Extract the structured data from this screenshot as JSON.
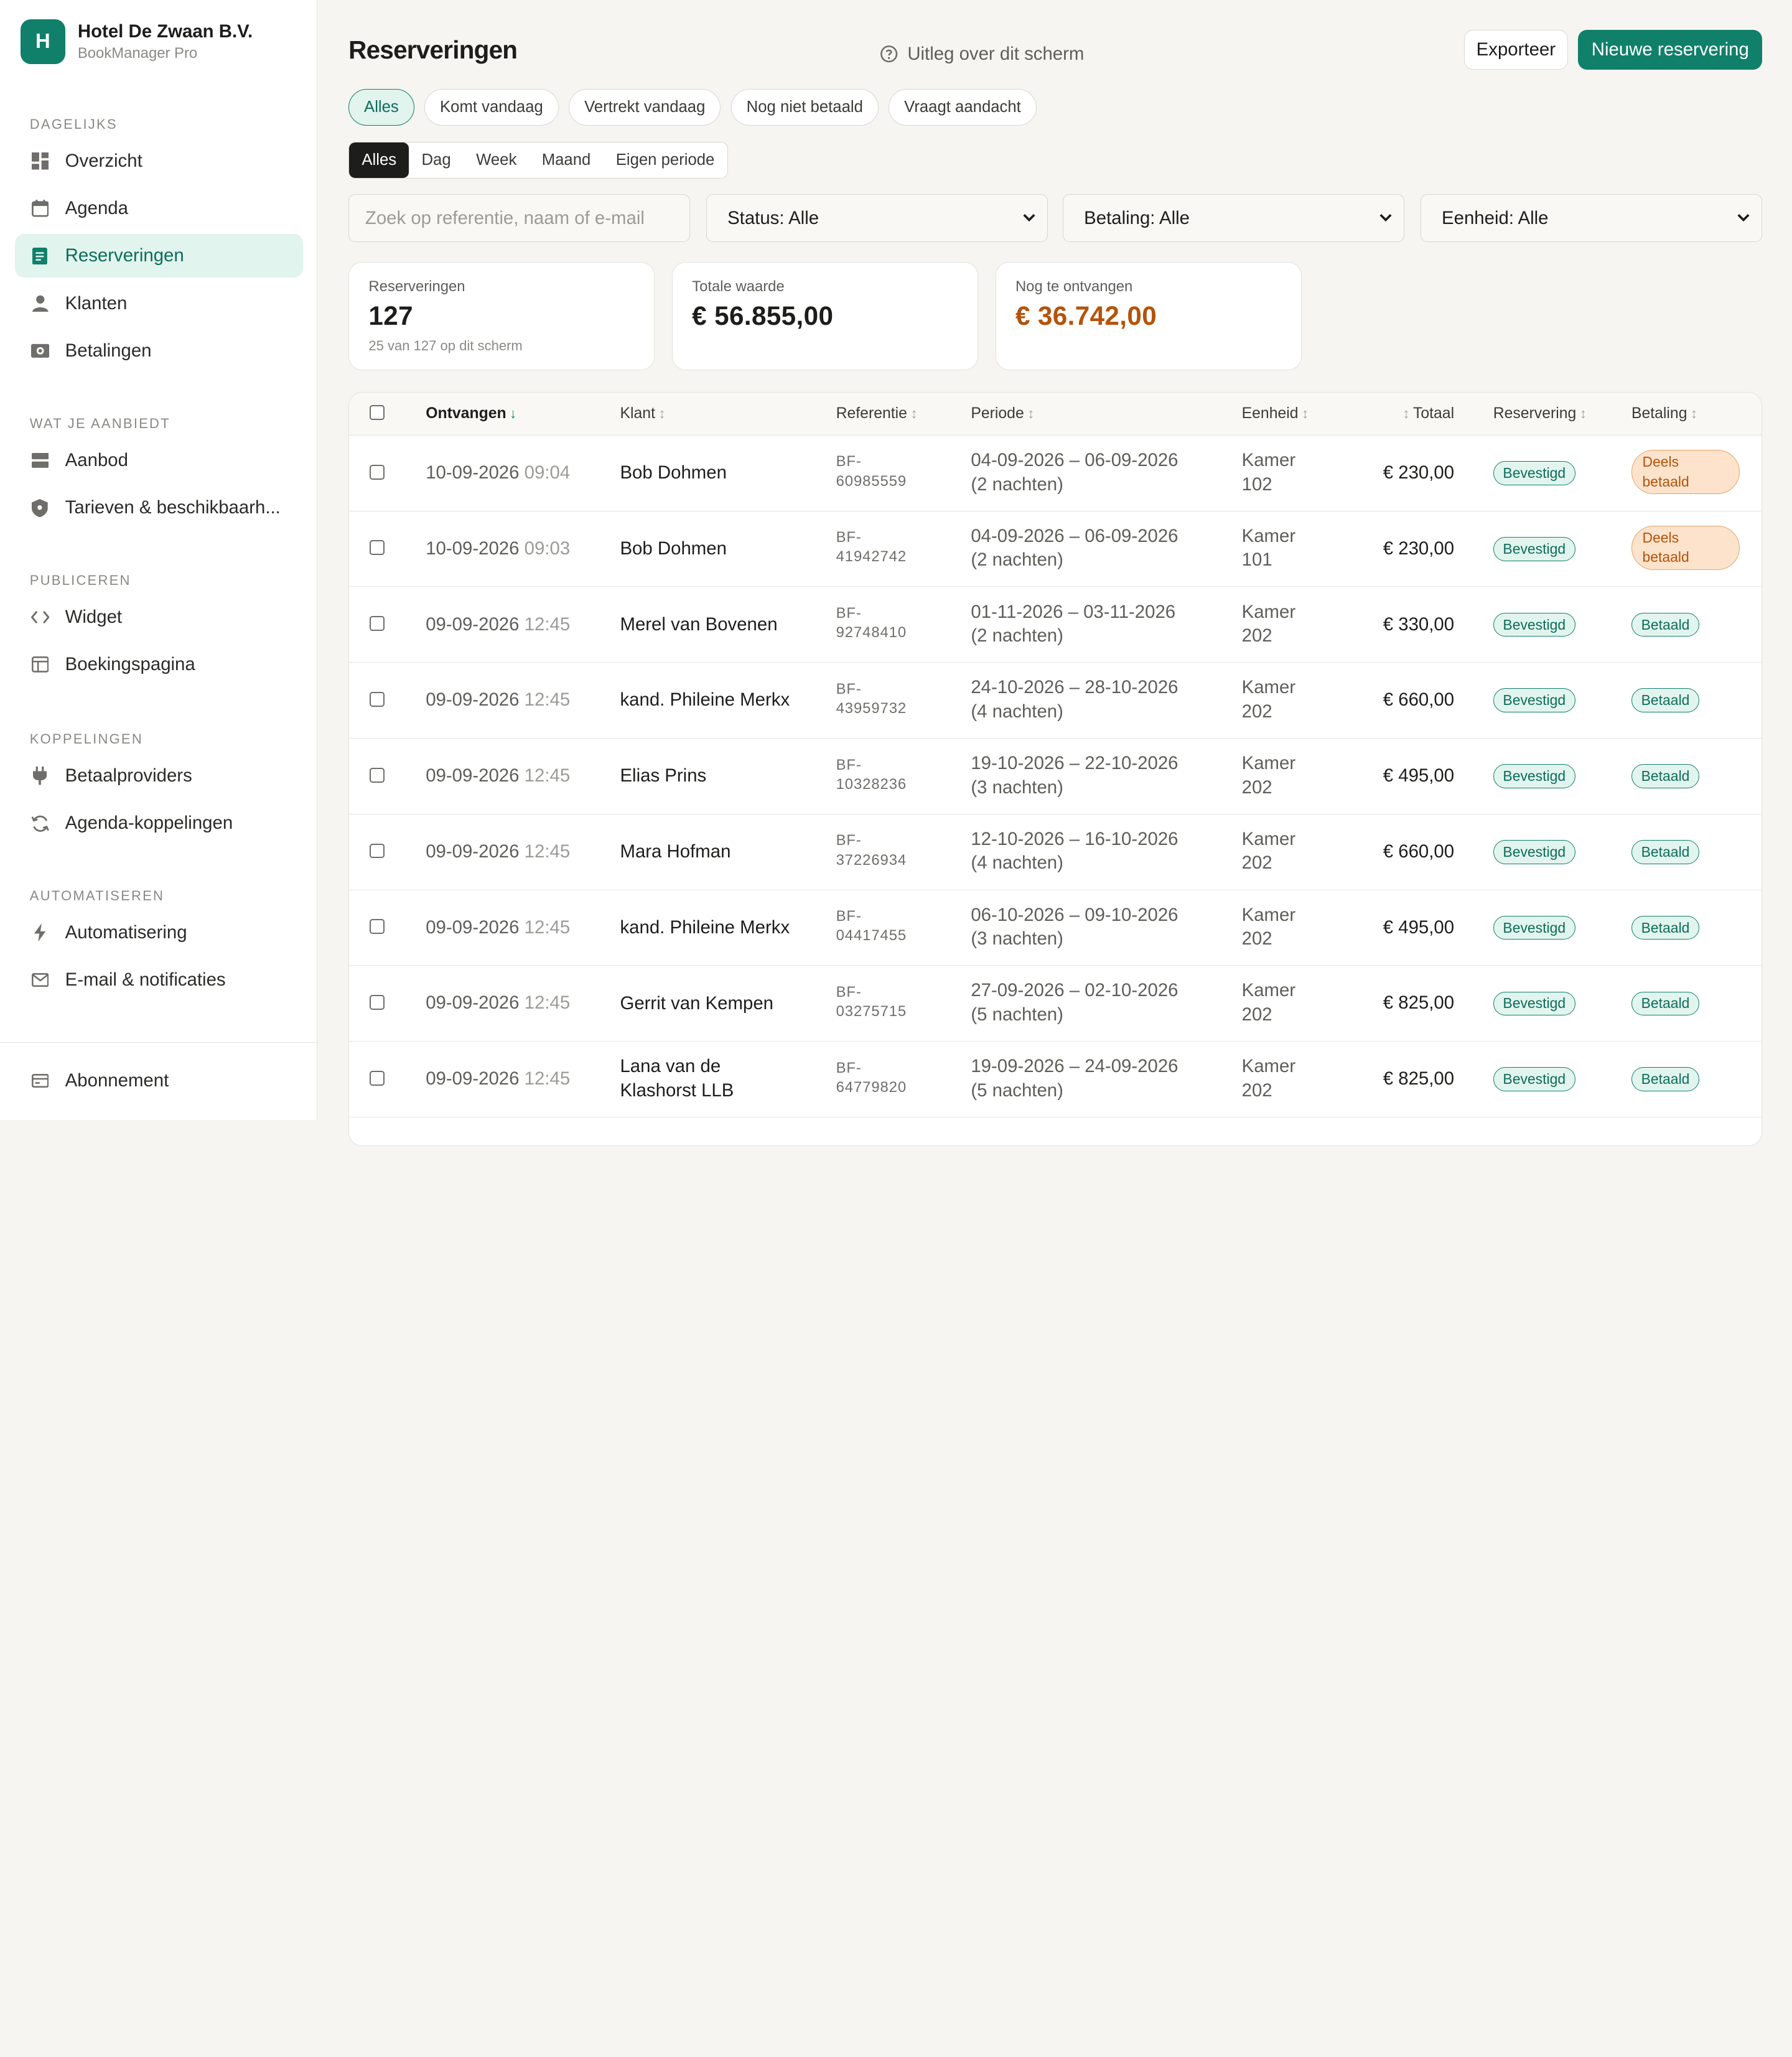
{
  "brand": {
    "initial": "H",
    "name": "Hotel De Zwaan B.V.",
    "product": "BookManager Pro"
  },
  "sidebar": {
    "sections": [
      {
        "title": "DAGELIJKS",
        "items": [
          {
            "label": "Overzicht",
            "icon": "dashboard-icon"
          },
          {
            "label": "Agenda",
            "icon": "calendar-icon"
          },
          {
            "label": "Reserveringen",
            "icon": "document-icon",
            "active": true
          },
          {
            "label": "Klanten",
            "icon": "user-icon"
          },
          {
            "label": "Betalingen",
            "icon": "payment-icon"
          }
        ]
      },
      {
        "title": "WAT JE AANBIEDT",
        "items": [
          {
            "label": "Aanbod",
            "icon": "offer-icon"
          },
          {
            "label": "Tarieven & beschikbaarh...",
            "icon": "tag-shield-icon"
          }
        ]
      },
      {
        "title": "PUBLICEREN",
        "items": [
          {
            "label": "Widget",
            "icon": "code-icon"
          },
          {
            "label": "Boekingspagina",
            "icon": "layout-icon"
          }
        ]
      },
      {
        "title": "KOPPELINGEN",
        "items": [
          {
            "label": "Betaalproviders",
            "icon": "plug-icon"
          },
          {
            "label": "Agenda-koppelingen",
            "icon": "sync-icon"
          }
        ]
      },
      {
        "title": "AUTOMATISEREN",
        "items": [
          {
            "label": "Automatisering",
            "icon": "bolt-icon"
          },
          {
            "label": "E-mail & notificaties",
            "icon": "mail-icon"
          }
        ]
      }
    ],
    "footer": {
      "label": "Abonnement",
      "icon": "card-icon"
    }
  },
  "header": {
    "title": "Reserveringen",
    "help": "Uitleg over dit scherm",
    "export": "Exporteer",
    "new": "Nieuwe reservering"
  },
  "quick_filters": [
    "Alles",
    "Komt vandaag",
    "Vertrekt vandaag",
    "Nog niet betaald",
    "Vraagt aandacht"
  ],
  "periods": [
    "Alles",
    "Dag",
    "Week",
    "Maand",
    "Eigen periode"
  ],
  "filters": {
    "search_placeholder": "Zoek op referentie, naam of e-mail",
    "status": "Status: Alle",
    "payment": "Betaling: Alle",
    "unit": "Eenheid: Alle"
  },
  "stats": [
    {
      "label": "Reserveringen",
      "value": "127",
      "sub": "25 van 127 op dit scherm"
    },
    {
      "label": "Totale waarde",
      "value": "€ 56.855,00"
    },
    {
      "label": "Nog te ontvangen",
      "value": "€ 36.742,00",
      "color": "#b45309"
    }
  ],
  "table": {
    "columns": {
      "received": "Ontvangen",
      "customer": "Klant",
      "reference": "Referentie",
      "period": "Periode",
      "unit": "Eenheid",
      "total": "Totaal",
      "reservation": "Reservering",
      "payment": "Betaling"
    },
    "rows": [
      {
        "date": "10-09-2026",
        "time": "09:04",
        "name": "Bob Dohmen",
        "ref1": "BF-",
        "ref2": "60985559",
        "period": "04-09-2026 – 06-09-2026",
        "nights": "(2 nachten)",
        "unit1": "Kamer",
        "unit2": "102",
        "total": "€ 230,00",
        "status": "Bevestigd",
        "payment": "Deels betaald",
        "payment_l1": "Deels",
        "payment_l2": "betaald"
      },
      {
        "date": "10-09-2026",
        "time": "09:03",
        "name": "Bob Dohmen",
        "ref1": "BF-",
        "ref2": "41942742",
        "period": "04-09-2026 – 06-09-2026",
        "nights": "(2 nachten)",
        "unit1": "Kamer",
        "unit2": "101",
        "total": "€ 230,00",
        "status": "Bevestigd",
        "payment": "Deels betaald",
        "payment_l1": "Deels",
        "payment_l2": "betaald"
      },
      {
        "date": "09-09-2026",
        "time": "12:45",
        "name": "Merel van Bovenen",
        "ref1": "BF-",
        "ref2": "92748410",
        "period": "01-11-2026 – 03-11-2026",
        "nights": "(2 nachten)",
        "unit1": "Kamer",
        "unit2": "202",
        "total": "€ 330,00",
        "status": "Bevestigd",
        "payment": "Betaald"
      },
      {
        "date": "09-09-2026",
        "time": "12:45",
        "name": "kand. Phileine Merkx",
        "ref1": "BF-",
        "ref2": "43959732",
        "period": "24-10-2026 – 28-10-2026",
        "nights": "(4 nachten)",
        "unit1": "Kamer",
        "unit2": "202",
        "total": "€ 660,00",
        "status": "Bevestigd",
        "payment": "Betaald"
      },
      {
        "date": "09-09-2026",
        "time": "12:45",
        "name": "Elias Prins",
        "ref1": "BF-",
        "ref2": "10328236",
        "period": "19-10-2026 – 22-10-2026",
        "nights": "(3 nachten)",
        "unit1": "Kamer",
        "unit2": "202",
        "total": "€ 495,00",
        "status": "Bevestigd",
        "payment": "Betaald"
      },
      {
        "date": "09-09-2026",
        "time": "12:45",
        "name": "Mara Hofman",
        "ref1": "BF-",
        "ref2": "37226934",
        "period": "12-10-2026 – 16-10-2026",
        "nights": "(4 nachten)",
        "unit1": "Kamer",
        "unit2": "202",
        "total": "€ 660,00",
        "status": "Bevestigd",
        "payment": "Betaald"
      },
      {
        "date": "09-09-2026",
        "time": "12:45",
        "name": "kand. Phileine Merkx",
        "ref1": "BF-",
        "ref2": "04417455",
        "period": "06-10-2026 – 09-10-2026",
        "nights": "(3 nachten)",
        "unit1": "Kamer",
        "unit2": "202",
        "total": "€ 495,00",
        "status": "Bevestigd",
        "payment": "Betaald"
      },
      {
        "date": "09-09-2026",
        "time": "12:45",
        "name": "Gerrit van Kempen",
        "ref1": "BF-",
        "ref2": "03275715",
        "period": "27-09-2026 – 02-10-2026",
        "nights": "(5 nachten)",
        "unit1": "Kamer",
        "unit2": "202",
        "total": "€ 825,00",
        "status": "Bevestigd",
        "payment": "Betaald"
      },
      {
        "date": "09-09-2026",
        "time": "12:45",
        "name": "Lana van de Klashorst LLB",
        "name1": "Lana van de",
        "name2": "Klashorst LLB",
        "ref1": "BF-",
        "ref2": "64779820",
        "period": "19-09-2026 – 24-09-2026",
        "nights": "(5 nachten)",
        "unit1": "Kamer",
        "unit2": "202",
        "total": "€ 825,00",
        "status": "Bevestigd",
        "payment": "Betaald"
      }
    ]
  },
  "colors": {
    "accent": "#10806a",
    "accent_bg": "#e2f4ee",
    "warning": "#b45309",
    "warning_bg": "#fde3cc"
  }
}
